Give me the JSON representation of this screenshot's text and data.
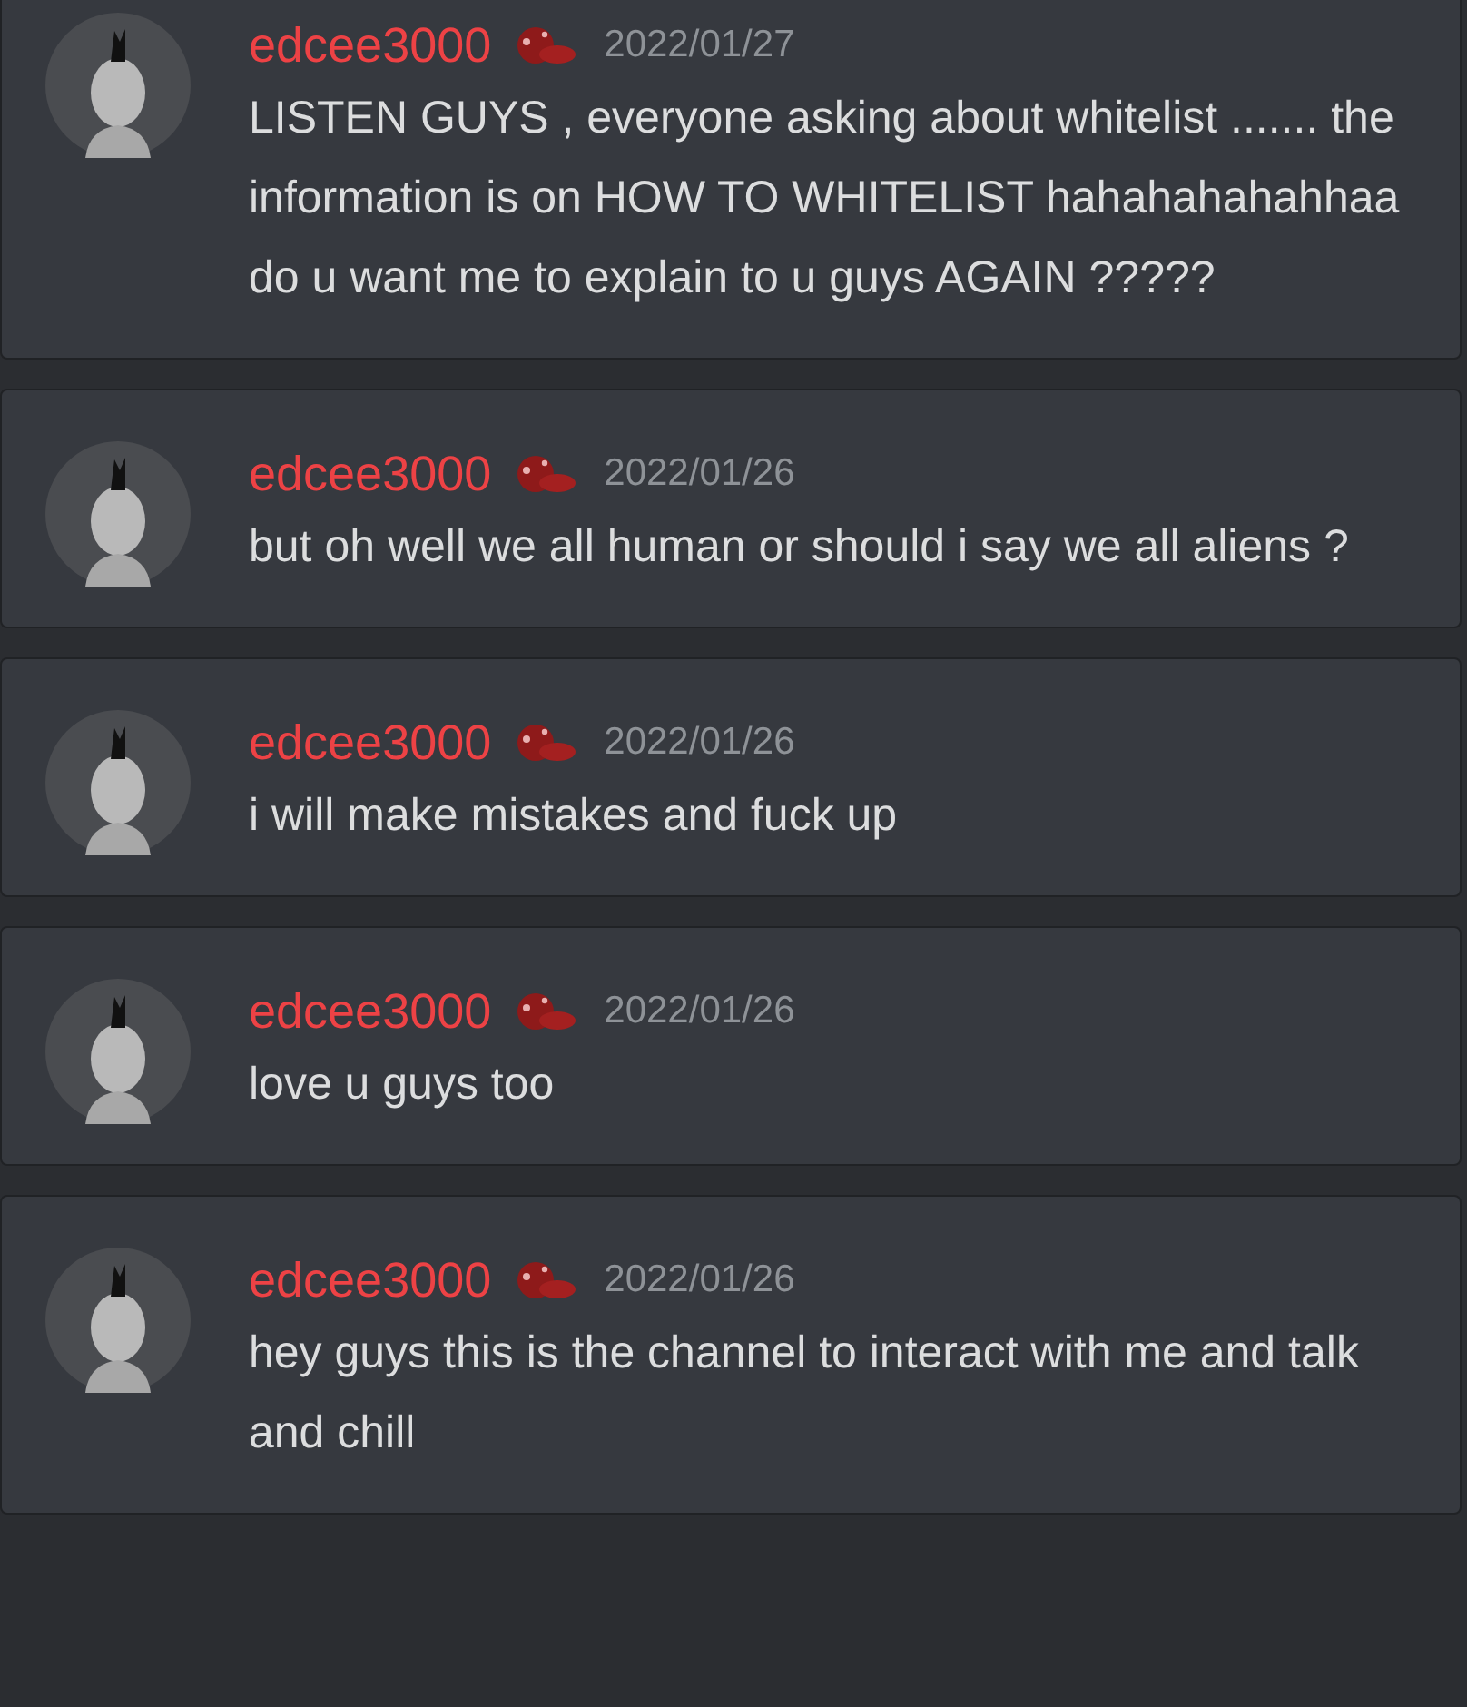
{
  "messages": [
    {
      "author": "edcee3000",
      "date": "2022/01/27",
      "text": "LISTEN GUYS , everyone asking about whitelist ....... the information is on HOW TO WHITELIST hahahahahahhaa do u want me to explain to u guys AGAIN ?????"
    },
    {
      "author": "edcee3000",
      "date": "2022/01/26",
      "text": "but oh well we all human or should i say we all aliens ?"
    },
    {
      "author": "edcee3000",
      "date": "2022/01/26",
      "text": "i will make mistakes and fuck up"
    },
    {
      "author": "edcee3000",
      "date": "2022/01/26",
      "text": "love u guys too"
    },
    {
      "author": "edcee3000",
      "date": "2022/01/26",
      "text": "hey guys this is the channel to interact with me and talk and chill"
    }
  ]
}
